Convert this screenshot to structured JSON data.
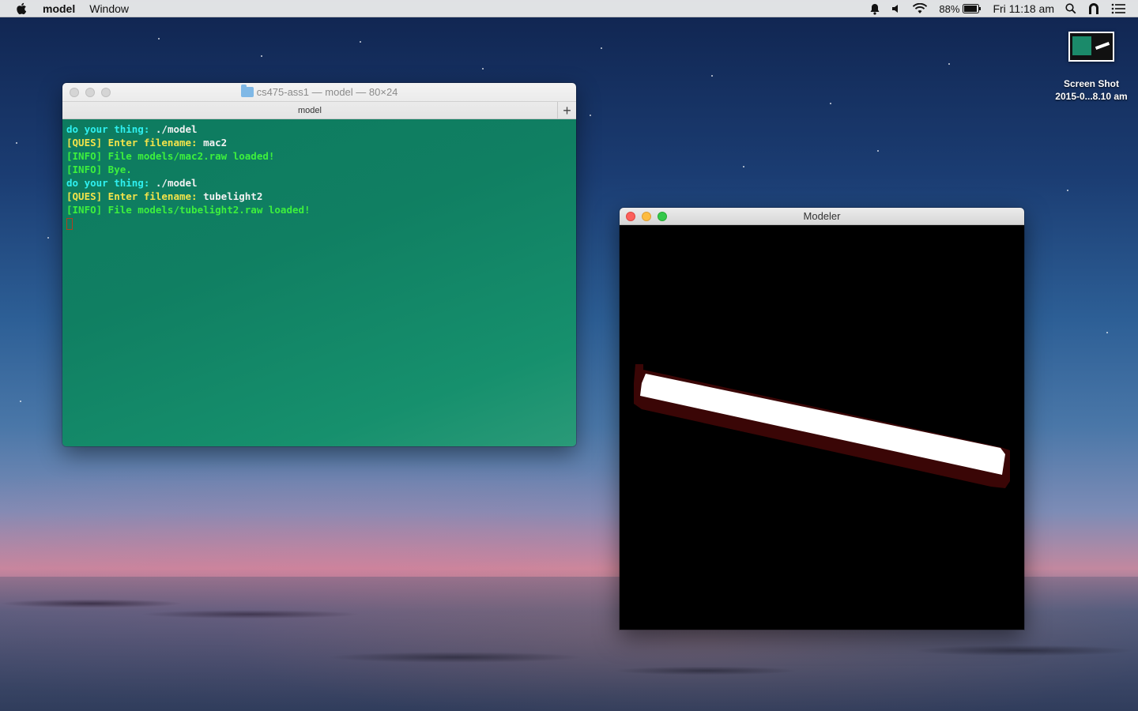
{
  "menubar": {
    "app_name": "model",
    "menus": [
      "Window"
    ],
    "battery_percent": "88%",
    "clock": "Fri 11:18 am"
  },
  "desktop": {
    "icon_label_1": "Screen Shot",
    "icon_label_2": "2015-0...8.10 am"
  },
  "terminal": {
    "title": "cs475-ass1 — model — 80×24",
    "tab_label": "model",
    "new_tab_label": "+",
    "lines": [
      {
        "parts": [
          {
            "text": "do your thing: ",
            "color": "cyan"
          },
          {
            "text": "./model",
            "color": "white"
          }
        ]
      },
      {
        "parts": [
          {
            "text": "[QUES] Enter filename: ",
            "color": "yellow"
          },
          {
            "text": "mac2",
            "color": "white"
          }
        ]
      },
      {
        "parts": [
          {
            "text": "[INFO] File models/mac2.raw loaded!",
            "color": "green"
          }
        ]
      },
      {
        "parts": [
          {
            "text": "[INFO] Bye.",
            "color": "green"
          }
        ]
      },
      {
        "parts": [
          {
            "text": "do your thing: ",
            "color": "cyan"
          },
          {
            "text": "./model",
            "color": "white"
          }
        ]
      },
      {
        "parts": [
          {
            "text": "[QUES] Enter filename: ",
            "color": "yellow"
          },
          {
            "text": "tubelight2",
            "color": "white"
          }
        ]
      },
      {
        "parts": [
          {
            "text": "[INFO] File models/tubelight2.raw loaded!",
            "color": "green"
          }
        ]
      }
    ]
  },
  "modeler": {
    "title": "Modeler",
    "scene": {
      "background_color": "#000000",
      "tube_color": "#ffffff",
      "holder_color": "#3a0606"
    }
  },
  "colors": {
    "terminal_bg": "#0f7d60",
    "cyan": "#2ff0f0",
    "yellow": "#f2e34a",
    "green": "#3df03d",
    "white": "#f2f2f2"
  }
}
